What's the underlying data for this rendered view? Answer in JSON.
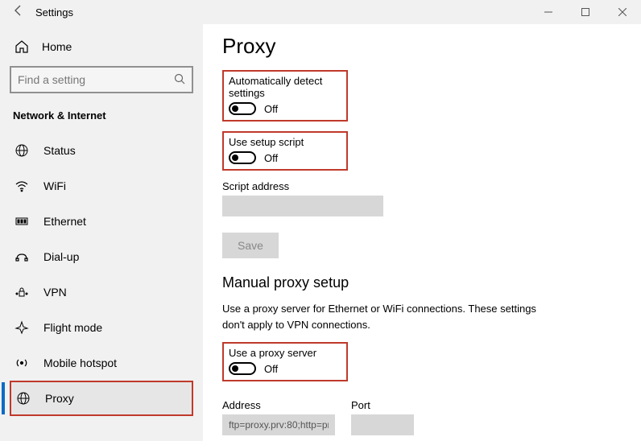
{
  "window": {
    "title": "Settings"
  },
  "sidebar": {
    "home": "Home",
    "search_placeholder": "Find a setting",
    "section": "Network & Internet",
    "items": [
      {
        "label": "Status"
      },
      {
        "label": "WiFi"
      },
      {
        "label": "Ethernet"
      },
      {
        "label": "Dial-up"
      },
      {
        "label": "VPN"
      },
      {
        "label": "Flight mode"
      },
      {
        "label": "Mobile hotspot"
      },
      {
        "label": "Proxy"
      }
    ]
  },
  "main": {
    "title": "Proxy",
    "auto_detect": {
      "label": "Automatically detect settings",
      "state": "Off"
    },
    "setup_script": {
      "label": "Use setup script",
      "state": "Off"
    },
    "script_address_label": "Script address",
    "script_address_value": "",
    "save": "Save",
    "manual_heading": "Manual proxy setup",
    "manual_desc": "Use a proxy server for Ethernet or WiFi connections. These settings don't apply to VPN connections.",
    "use_proxy": {
      "label": "Use a proxy server",
      "state": "Off"
    },
    "address_label": "Address",
    "address_value": "ftp=proxy.prv:80;http=pr",
    "port_label": "Port",
    "port_value": ""
  }
}
